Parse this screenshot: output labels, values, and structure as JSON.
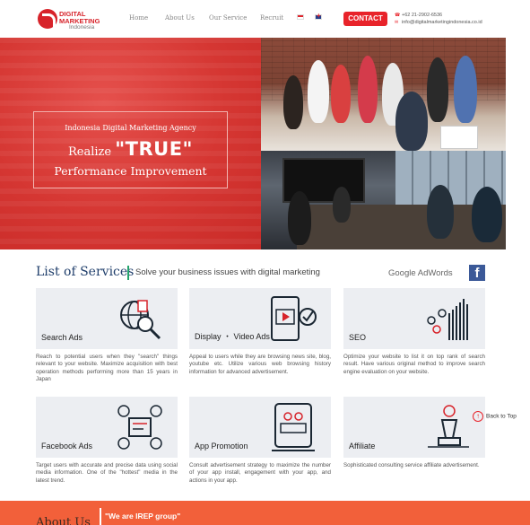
{
  "header": {
    "logo": {
      "line1": "DIGITAL",
      "line2": "MARKETING",
      "line3": "Indonesia"
    },
    "nav": [
      "Home",
      "About Us",
      "Our Service",
      "Recruit"
    ],
    "contact_label": "CONTACT",
    "phone": "+62 21-2902-6536",
    "email": "info@digitalmarketingindonesia.co.id"
  },
  "hero": {
    "agency": "Indonesia Digital Marketing Agency",
    "realize": "Realize ",
    "true": "\"TRUE\"",
    "performance": "Performance Improvement"
  },
  "services": {
    "title": "List of Services",
    "subtitle": "Solve your business issues with digital marketing",
    "google_adwords": "Google AdWords",
    "facebook_logo": "f",
    "cards": [
      {
        "label": "Search Ads",
        "icon": "globe-search-icon",
        "desc": "Reach to potential users when they \"search\" things relevant to your website. Maximize acquisition with best operation methods performing more than 15 years in Japan"
      },
      {
        "label": "Display ・ Video Ads",
        "icon": "mobile-video-icon",
        "desc": "Appeal to users while they are browsing news site, blog, youtube etc. Utilize various web browsing history information for advanced advertisement."
      },
      {
        "label": "SEO",
        "icon": "ranking-chart-icon",
        "desc": "Optimize your website to list it on top rank of search result. Have various original method to improve search engine evaluation on your website."
      },
      {
        "label": "Facebook Ads",
        "icon": "social-network-icon",
        "desc": "Target users with accurate and precise data using social media information. One of the \"hottest\" media in the latest trend."
      },
      {
        "label": "App Promotion",
        "icon": "app-promotion-icon",
        "desc": "Consult advertisement strategy to maximize the number of your app install, engagement with your app, and actions in your app."
      },
      {
        "label": "Affiliate",
        "icon": "affiliate-chess-icon",
        "desc": "Sophisticated consulting service affiliate advertisement."
      }
    ]
  },
  "back_to_top": "Back to Top",
  "about": {
    "title": "About Us",
    "tagline": "\"We are IREP group\""
  },
  "colors": {
    "brand_red": "#e8232a",
    "navy": "#1f3e6b",
    "green": "#22a36b",
    "orange_band": "#f2603a"
  }
}
